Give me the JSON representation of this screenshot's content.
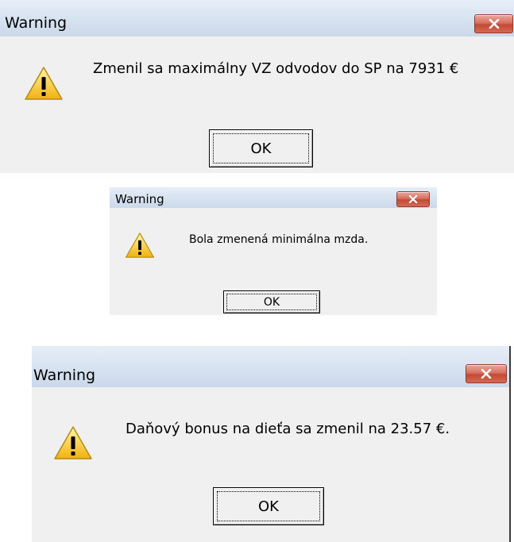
{
  "dialogs": [
    {
      "title": "Warning",
      "message": "Zmenil sa maximálny VZ odvodov do SP na 7931 €",
      "ok_label": "OK",
      "icon": "warning-triangle-icon",
      "close_icon": "close-icon"
    },
    {
      "title": "Warning",
      "message": "Bola zmenená minimálna mzda.",
      "ok_label": "OK",
      "icon": "warning-triangle-icon",
      "close_icon": "close-icon"
    },
    {
      "title": "Warning",
      "message": "Daňový bonus na dieťa sa zmenil na 23.57 €.",
      "ok_label": "OK",
      "icon": "warning-triangle-icon",
      "close_icon": "close-icon"
    }
  ],
  "colors": {
    "titlebar": "#d5e1ef",
    "dialog_background": "#f0f0f0",
    "close_button": "#c34a35",
    "warning_yellow": "#f7d23a"
  }
}
